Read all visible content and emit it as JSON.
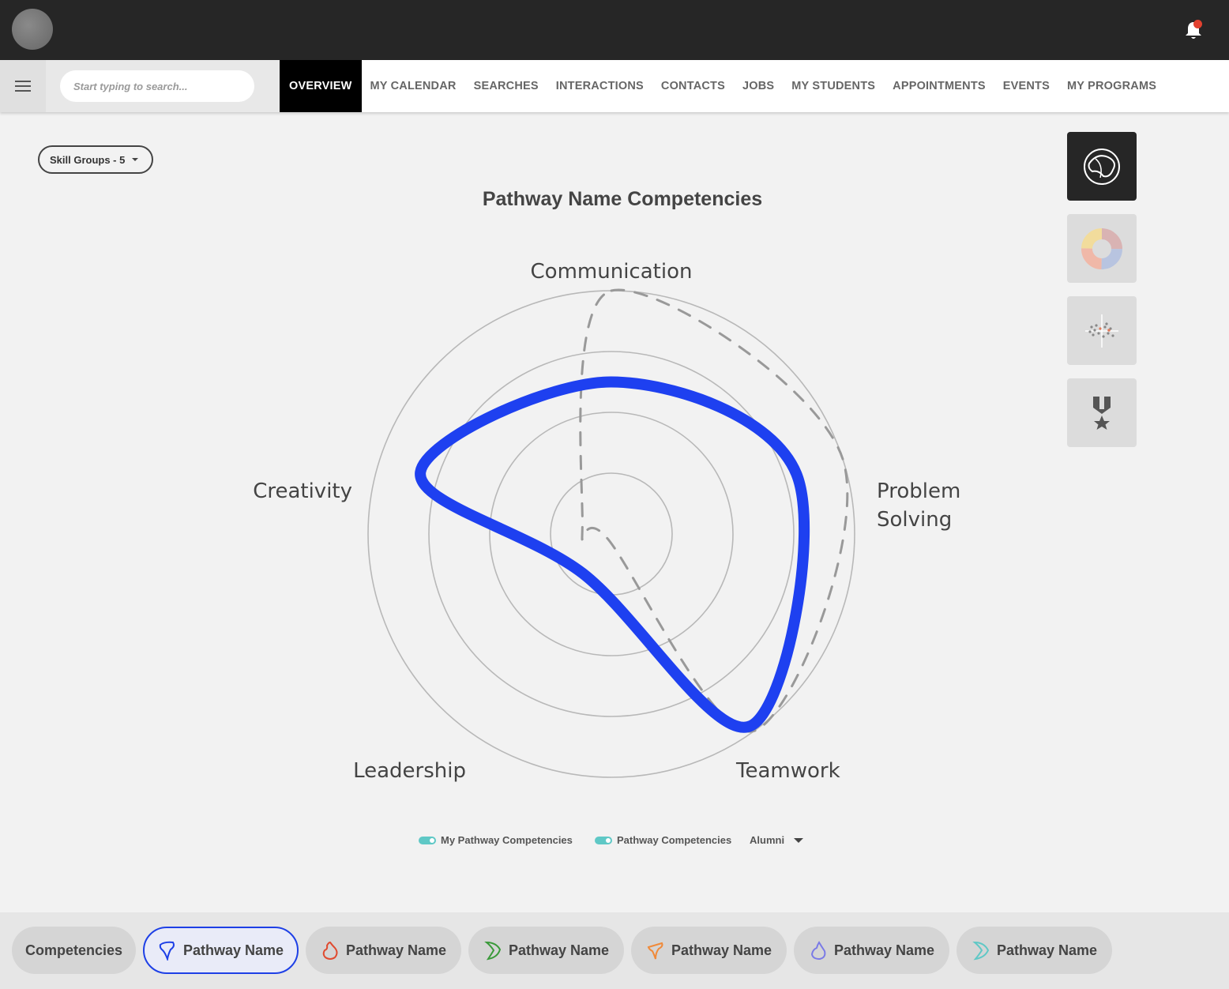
{
  "header": {
    "avatar_icon": "avatar-icon",
    "notification_icon": "bell-icon",
    "notification_badge_color": "#e2412f"
  },
  "search": {
    "placeholder": "Start typing to search..."
  },
  "nav": {
    "tabs": [
      {
        "label": "OVERVIEW",
        "active": true
      },
      {
        "label": "MY CALENDAR"
      },
      {
        "label": "SEARCHES"
      },
      {
        "label": "INTERACTIONS"
      },
      {
        "label": "CONTACTS"
      },
      {
        "label": "JOBS"
      },
      {
        "label": "MY STUDENTS"
      },
      {
        "label": "APPOINTMENTS"
      },
      {
        "label": "EVENTS"
      },
      {
        "label": "MY PROGRAMS"
      }
    ]
  },
  "filter": {
    "skill_groups_label": "Skill Groups - 5"
  },
  "chart_data": {
    "type": "radar",
    "title": "Pathway Name Competencies",
    "axes": [
      "Communication",
      "Problem Solving",
      "Teamwork",
      "Leadership",
      "Creativity"
    ],
    "rings": 4,
    "range": [
      0,
      4
    ],
    "series": [
      {
        "name": "My Pathway Competencies",
        "color": "#1e40f0",
        "style": "solid",
        "values": [
          2.5,
          3.2,
          3.9,
          0.8,
          3.3
        ]
      },
      {
        "name": "Pathway Competencies",
        "color": "#999999",
        "style": "dashed",
        "values": [
          4.0,
          4.0,
          4.0,
          0.1,
          0.5
        ]
      }
    ]
  },
  "legend": {
    "my_label": "My Pathway Competencies",
    "pathway_label": "Pathway Competencies",
    "dropdown_value": "Alumni",
    "toggle_color": "#5fc8c6"
  },
  "sidebar": {
    "views": [
      {
        "icon": "radar-chart-icon",
        "active": true
      },
      {
        "icon": "donut-chart-icon"
      },
      {
        "icon": "scatter-plot-icon"
      },
      {
        "icon": "medal-icon"
      }
    ]
  },
  "bottom": {
    "chips": [
      {
        "label": "Competencies"
      },
      {
        "label": "Pathway Name",
        "color": "#1e40e6",
        "active": true
      },
      {
        "label": "Pathway Name",
        "color": "#e04a2f"
      },
      {
        "label": "Pathway Name",
        "color": "#3a9a3a"
      },
      {
        "label": "Pathway Name",
        "color": "#f08a3a"
      },
      {
        "label": "Pathway Name",
        "color": "#7a7ae6"
      },
      {
        "label": "Pathway Name",
        "color": "#5fc8c6"
      }
    ]
  }
}
